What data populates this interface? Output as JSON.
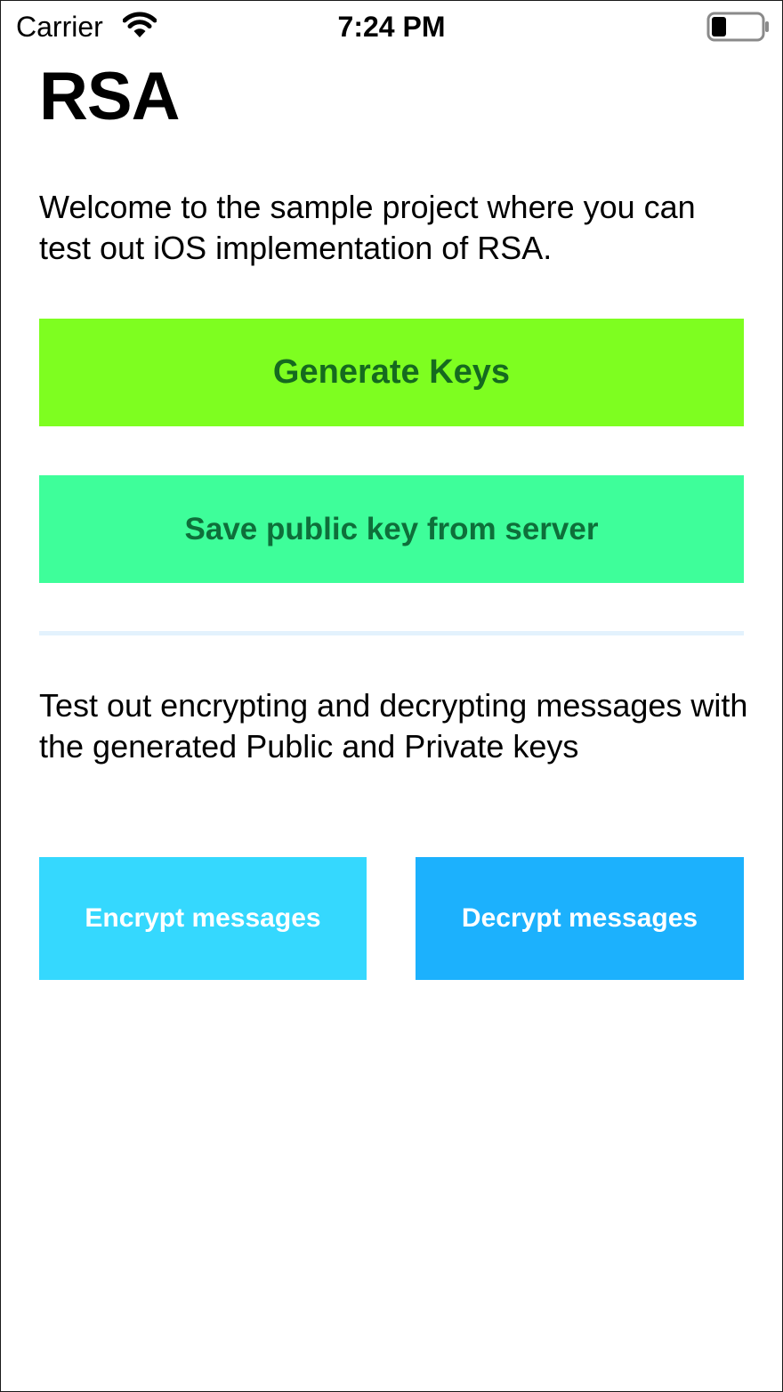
{
  "status_bar": {
    "carrier": "Carrier",
    "time": "7:24 PM",
    "wifi_icon": "wifi-icon",
    "battery_icon": "battery-icon",
    "battery_level": 0.3
  },
  "page": {
    "title": "RSA",
    "intro": "Welcome to the sample project where you can test out iOS implementation of RSA.",
    "section_text": "Test out encrypting and decrypting messages with the generated Public and Private keys"
  },
  "buttons": {
    "generate_keys": {
      "label": "Generate Keys",
      "bg": "#7EFE20",
      "color": "#156A1F"
    },
    "save_public_key": {
      "label": "Save public key from server",
      "bg": "#3EFE9A",
      "color": "#0E6F3A"
    },
    "encrypt": {
      "label": "Encrypt messages",
      "bg": "#35D8FE",
      "color": "#FFFFFF"
    },
    "decrypt": {
      "label": "Decrypt messages",
      "bg": "#1CB1FD",
      "color": "#FFFFFF"
    }
  },
  "colors": {
    "divider": "#E3F2FD",
    "background": "#FFFFFF",
    "text": "#000000"
  }
}
